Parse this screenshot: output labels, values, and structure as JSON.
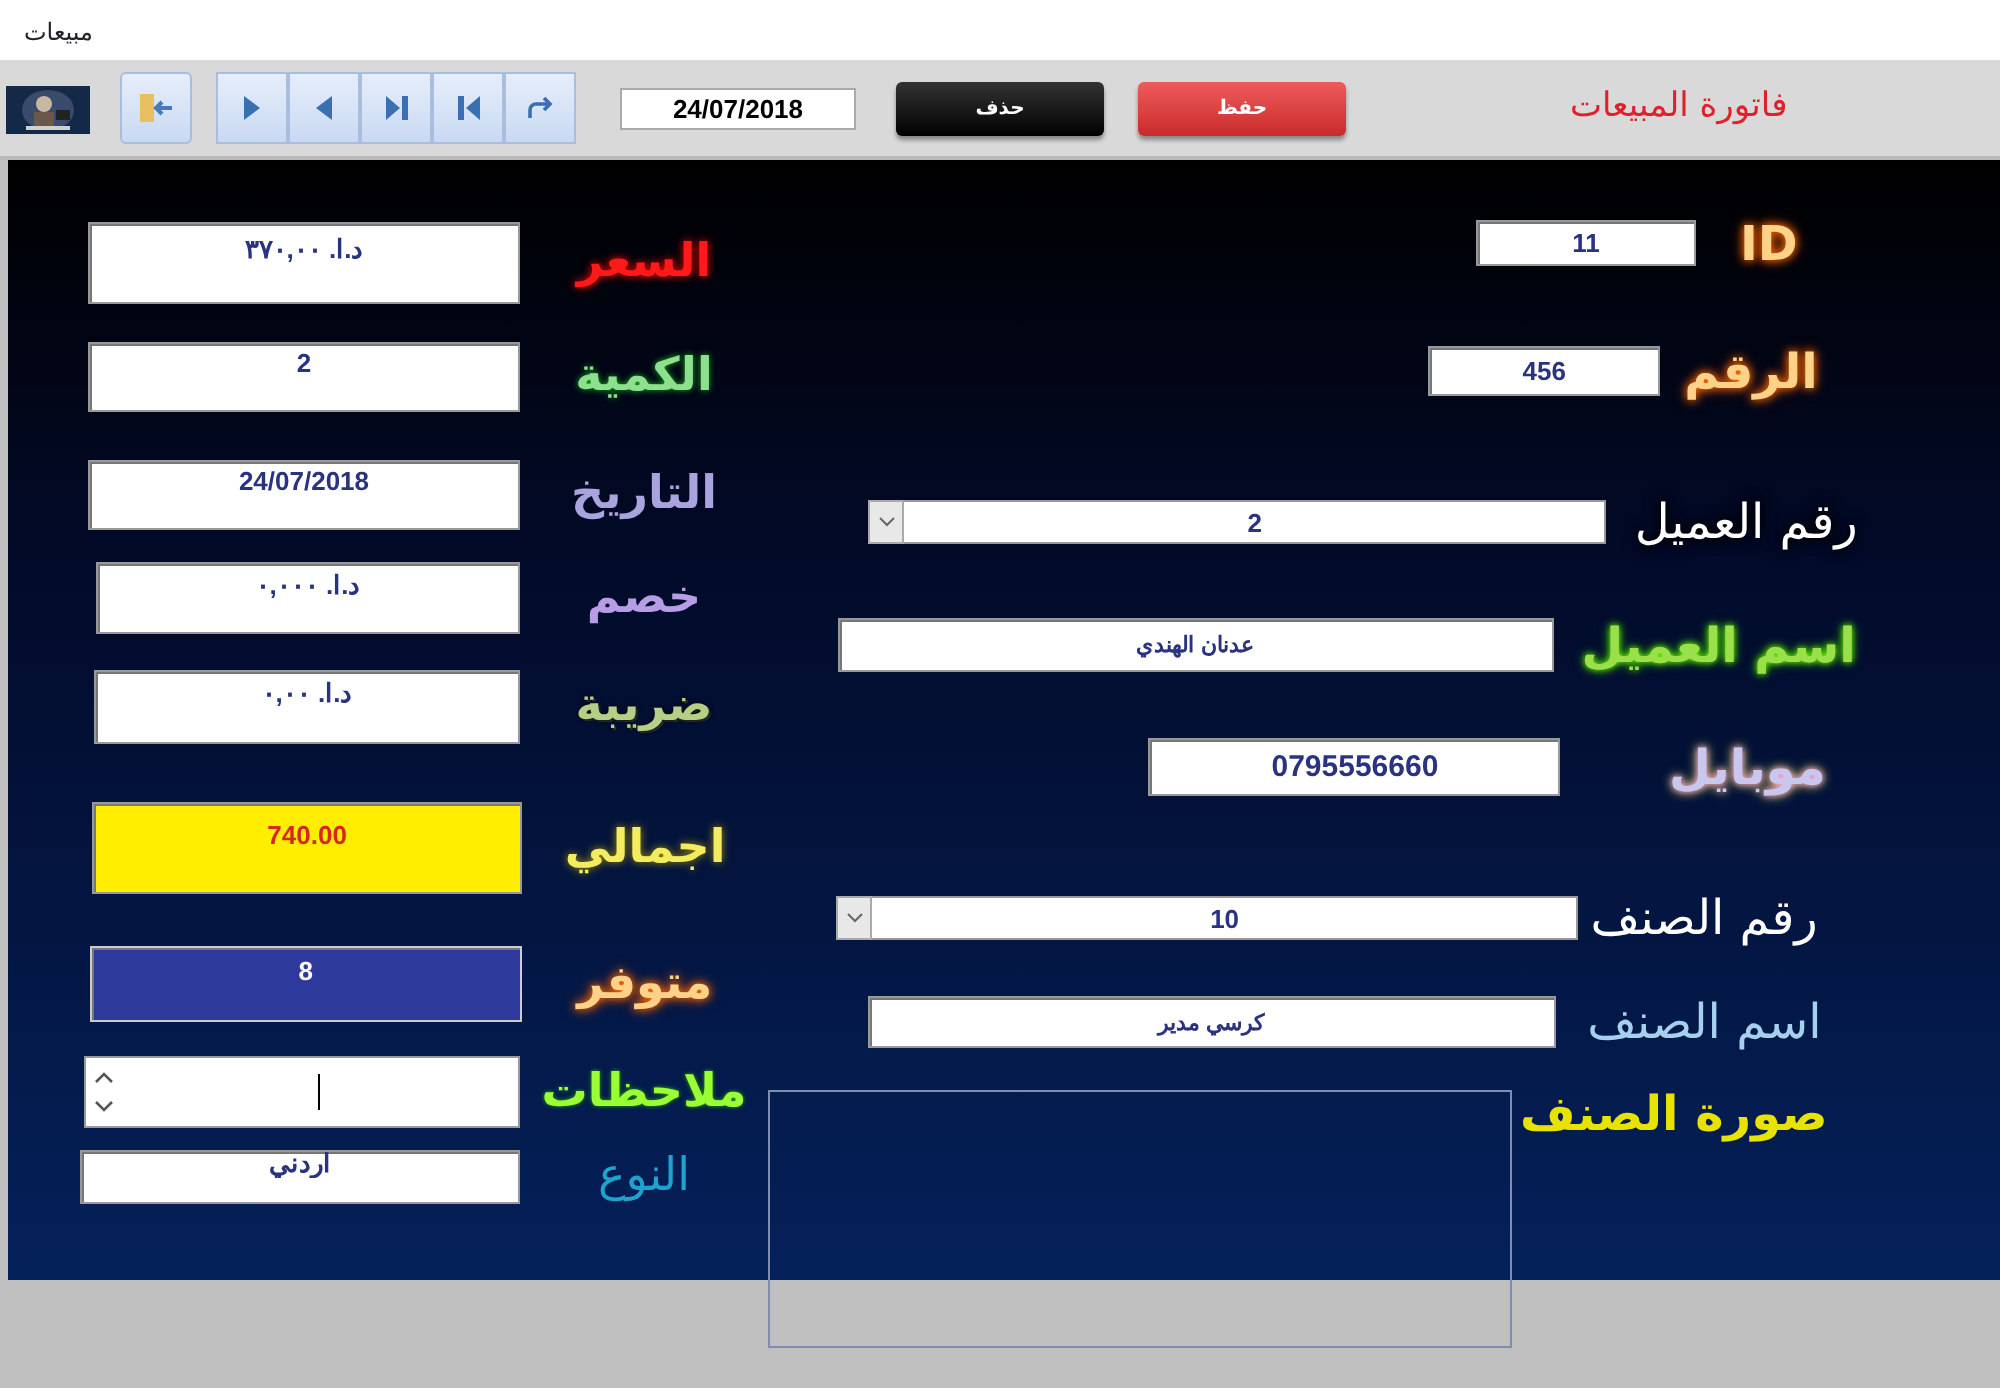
{
  "window": {
    "title": "مبيعات"
  },
  "toolbar": {
    "date": "24/07/2018",
    "delete_button": "حذف",
    "save_button": "حفظ",
    "form_title": "فاتورة المبيعات",
    "nav_buttons": [
      {
        "kind": "exit"
      },
      {
        "kind": "next"
      },
      {
        "kind": "previous"
      },
      {
        "kind": "last"
      },
      {
        "kind": "first"
      },
      {
        "kind": "refresh"
      }
    ]
  },
  "left_fields": [
    {
      "label": "السعر",
      "kind": "text",
      "value": "د.ا.‏ ٣٧٠,٠٠"
    },
    {
      "label": "الكمية",
      "kind": "text",
      "value": "2"
    },
    {
      "label": "التاريخ",
      "kind": "text",
      "value": "24/07/2018"
    },
    {
      "label": "خصم",
      "kind": "text",
      "value": "د.ا.‏ ٠,٠٠٠"
    },
    {
      "label": "ضريبة",
      "kind": "text",
      "value": "د.ا.‏ ٠,٠٠"
    },
    {
      "label": "اجمالي",
      "kind": "total",
      "value": "740.00"
    },
    {
      "label": "متوفر",
      "kind": "stock",
      "value": "8"
    },
    {
      "label": "ملاحظات",
      "kind": "memo"
    },
    {
      "label": "النوع",
      "kind": "text",
      "value": "اردني"
    }
  ],
  "right_fields": [
    {
      "label": "ID",
      "kind": "text",
      "value": "11"
    },
    {
      "label": "الرقم",
      "kind": "text",
      "value": "456"
    },
    {
      "label": "رقم العميل",
      "kind": "combo",
      "value": "2"
    },
    {
      "label": "اسم العميل",
      "kind": "text",
      "value": "عدنان الهندي"
    },
    {
      "label": "موبايل",
      "kind": "text",
      "value": "0795556660"
    },
    {
      "label": "رقم الصنف",
      "kind": "combo",
      "value": "10"
    },
    {
      "label": "اسم الصنف",
      "kind": "text",
      "value": "كرسي مدير"
    },
    {
      "label": "صورة الصنف",
      "kind": "picture"
    }
  ]
}
